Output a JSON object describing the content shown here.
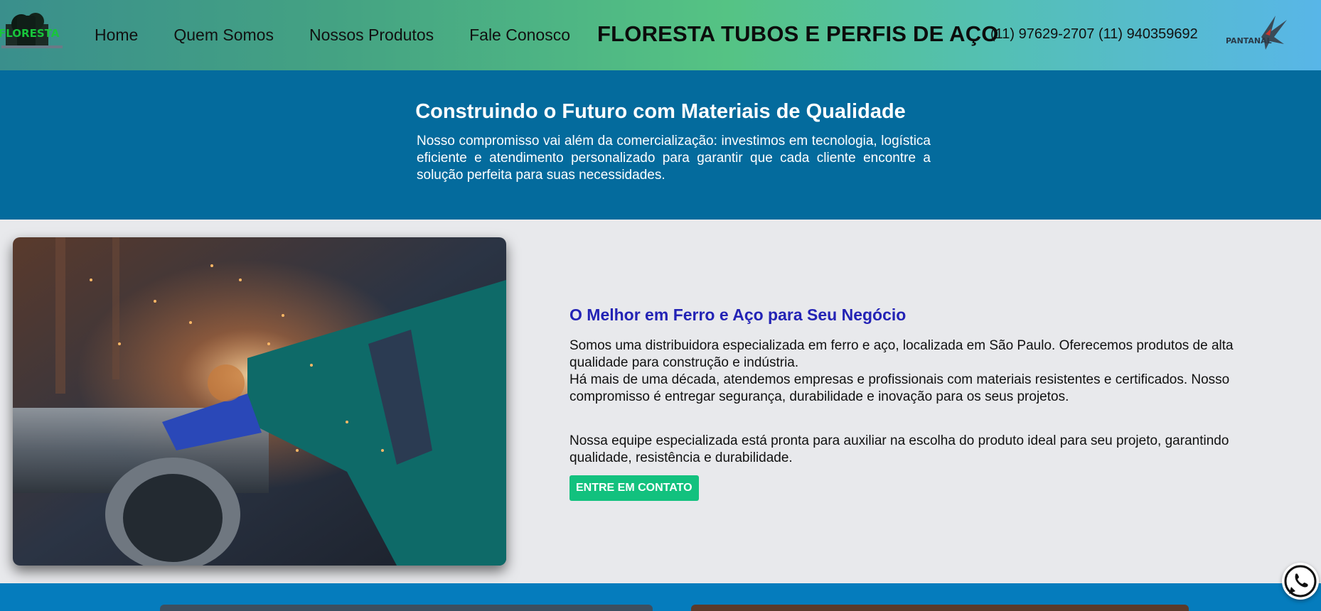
{
  "header": {
    "logo_left_alt": "FLORESTA",
    "nav": [
      "Home",
      "Quem Somos",
      "Nossos Produtos",
      "Fale Conosco"
    ],
    "brand": "FLORESTA TUBOS E PERFIS DE AÇO",
    "phones": "(11) 97629-2707 (11) 940359692",
    "logo_right_alt": "PANTANAL"
  },
  "hero": {
    "title": "Construindo o Futuro com Materiais de Qualidade",
    "text": "Nosso compromisso vai além da comercialização: investimos em tecnologia, logística eficiente e atendimento personalizado para garantir que cada cliente encontre a solução perfeita para suas necessidades."
  },
  "about": {
    "heading": "O Melhor em Ferro e Aço para Seu Negócio",
    "p1": "Somos uma distribuidora especializada em ferro e aço, localizada em São Paulo. Oferecemos produtos de alta qualidade para construção e indústria.",
    "p2": "Há mais de uma década, atendemos empresas e profissionais com materiais resistentes e certificados. Nosso compromisso é entregar segurança, durabilidade e inovação para os seus projetos.",
    "p3": "Nossa equipe especializada está pronta para auxiliar na escolha do produto ideal para seu projeto, garantindo qualidade, resistência e durabilidade.",
    "cta": "ENTRE EM CONTATO"
  },
  "colors": {
    "hero_bg": "#046b9d",
    "heading_blue": "#2323b5",
    "cta_green": "#12c17e",
    "bottom_band": "#057cbd"
  },
  "icons": {
    "whatsapp": "whatsapp-icon"
  }
}
